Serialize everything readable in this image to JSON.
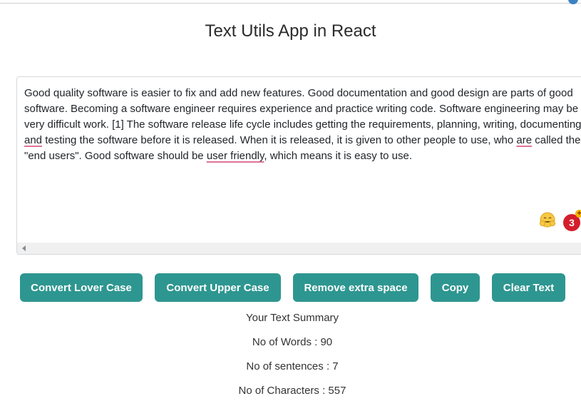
{
  "app": {
    "title": "Text Utils App in React"
  },
  "editor": {
    "segments": [
      "Good quality software is easier to fix and add new features. Good documentation and good design are parts of good software. Becoming a software engineer requires experience and practice writing code. Software engineering may be very difficult work. [1] The software release life cycle includes getting the requirements, planning, writing, documenting ",
      "and",
      " testing the software before it is released. When it is released, it is given to other people to use, who ",
      "are",
      " called the \"end users\". Good software should be ",
      "user friendly",
      ", which means it is easy to use."
    ],
    "badge_count": "3",
    "badge_plus": "+"
  },
  "buttons": {
    "lower": "Convert Lover Case",
    "upper": "Convert Upper Case",
    "remove_space": "Remove extra space",
    "copy": "Copy",
    "clear": "Clear Text"
  },
  "summary": {
    "heading": "Your Text Summary",
    "words": "No of Words : 90",
    "sentences": "No of sentences : 7",
    "characters": "No of Characters : 557"
  },
  "colors": {
    "button_bg": "#2e9690",
    "badge_bg": "#d41e2b",
    "spellcheck_underline": "#e0739a"
  }
}
